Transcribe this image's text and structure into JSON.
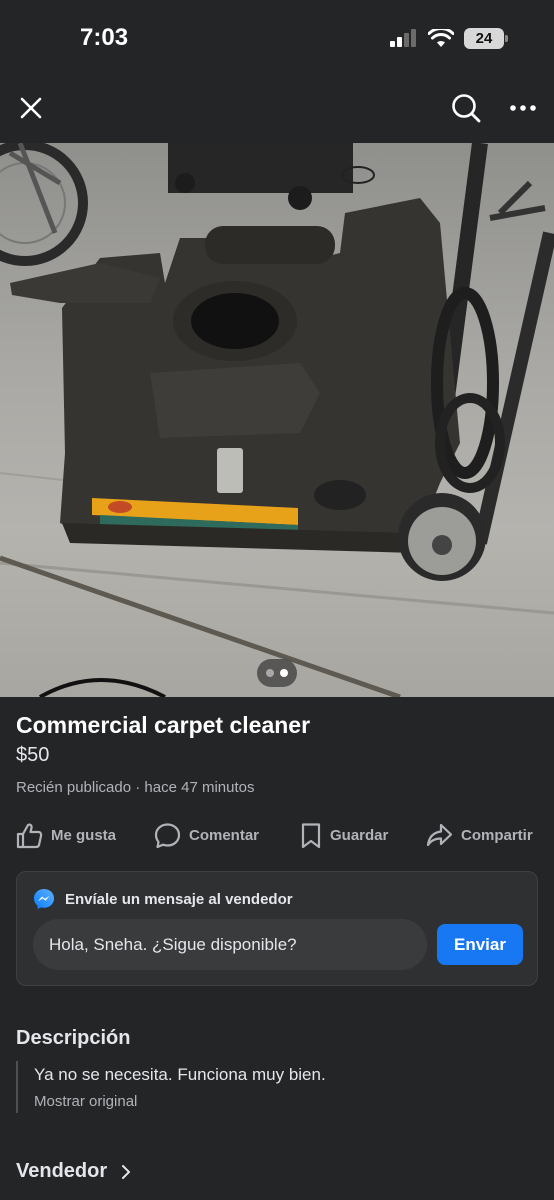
{
  "status_bar": {
    "time": "7:03",
    "battery": "24"
  },
  "nav": {
    "close_icon": "close-icon",
    "search_icon": "search-icon",
    "more_icon": "more-icon"
  },
  "photo": {
    "dots": 2,
    "active_dot": 1
  },
  "listing": {
    "title": "Commercial carpet cleaner",
    "price": "$50",
    "posted": "Recién publicado · hace 47 minutos"
  },
  "actions": [
    {
      "label": "Me gusta",
      "icon": "like-icon"
    },
    {
      "label": "Comentar",
      "icon": "comment-icon"
    },
    {
      "label": "Guardar",
      "icon": "bookmark-icon"
    },
    {
      "label": "Compartir",
      "icon": "share-icon"
    }
  ],
  "message": {
    "header": "Envíale un mensaje al vendedor",
    "input_value": "Hola, Sneha. ¿Sigue disponible?",
    "send_label": "Enviar"
  },
  "description": {
    "heading": "Descripción",
    "text": "Ya no se necesita. Funciona muy bien.",
    "show_original": "Mostrar original"
  },
  "seller": {
    "heading": "Vendedor"
  },
  "colors": {
    "background": "#242526",
    "accent": "#1877f2",
    "text": "#e4e6eb",
    "muted": "#b0b3b8"
  }
}
